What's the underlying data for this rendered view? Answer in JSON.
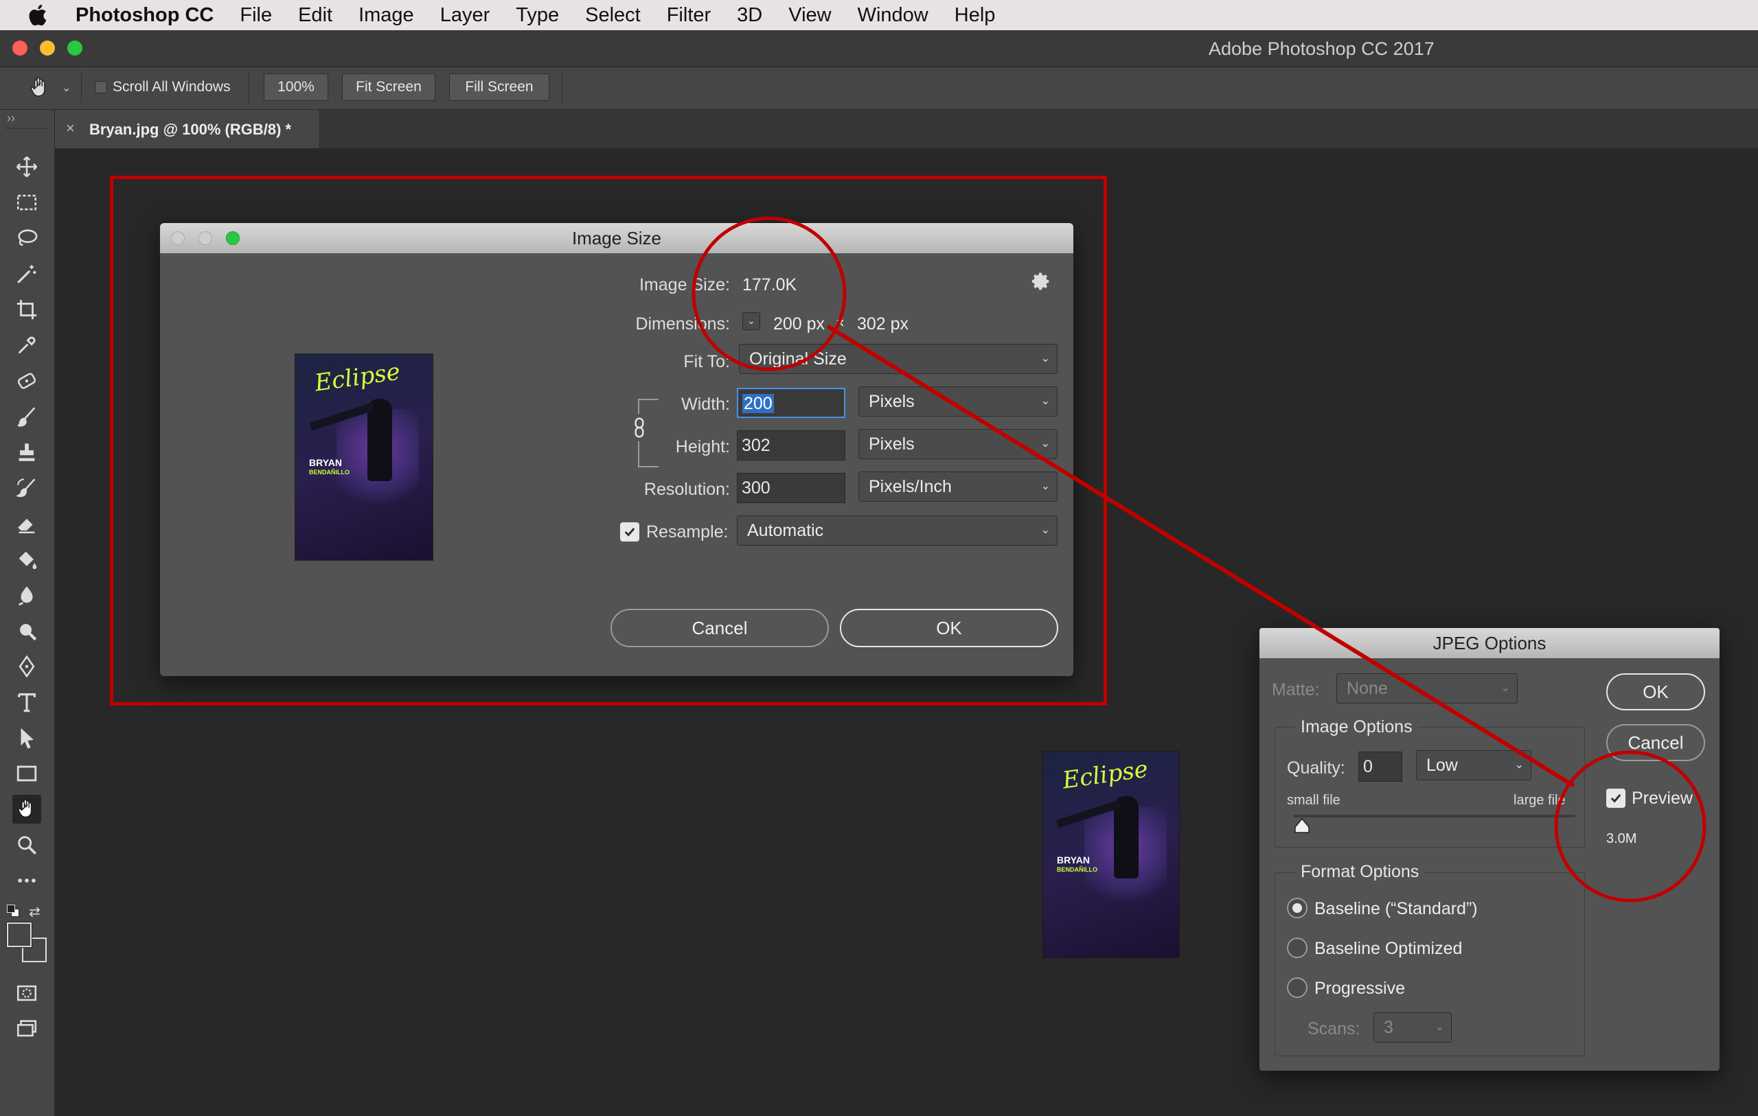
{
  "menubar": {
    "app_name": "Photoshop CC",
    "items": [
      "File",
      "Edit",
      "Image",
      "Layer",
      "Type",
      "Select",
      "Filter",
      "3D",
      "View",
      "Window",
      "Help"
    ]
  },
  "window": {
    "title": "Adobe Photoshop CC 2017"
  },
  "options_bar": {
    "tool_icon": "hand-icon",
    "scroll_all_label": "Scroll All Windows",
    "zoom_100": "100%",
    "fit_screen": "Fit Screen",
    "fill_screen": "Fill Screen"
  },
  "document_tab": {
    "close": "×",
    "label": "Bryan.jpg @ 100% (RGB/8) *"
  },
  "toolbar_expand": "››",
  "image_size": {
    "title": "Image Size",
    "image_size_label": "Image Size:",
    "image_size_value": "177.0K",
    "dimensions_label": "Dimensions:",
    "dim_width": "200 px",
    "dim_times": "×",
    "dim_height": "302 px",
    "fit_to_label": "Fit To:",
    "fit_to_value": "Original Size",
    "width_label": "Width:",
    "width_value": "200",
    "width_unit": "Pixels",
    "height_label": "Height:",
    "height_value": "302",
    "height_unit": "Pixels",
    "resolution_label": "Resolution:",
    "resolution_value": "300",
    "resolution_unit": "Pixels/Inch",
    "resample_label": "Resample:",
    "resample_value": "Automatic",
    "resample_checked": true,
    "cancel": "Cancel",
    "ok": "OK"
  },
  "poster": {
    "title": "Eclipse",
    "name": "BRYAN",
    "subtitle": "BENDAÑILLO"
  },
  "jpeg_options": {
    "title": "JPEG Options",
    "matte_label": "Matte:",
    "matte_value": "None",
    "ok": "OK",
    "cancel": "Cancel",
    "preview_label": "Preview",
    "preview_checked": true,
    "file_size": "3.0M",
    "image_options_legend": "Image Options",
    "quality_label": "Quality:",
    "quality_value": "0",
    "quality_preset": "Low",
    "small_file": "small file",
    "large_file": "large file",
    "quality_slider_level": 0,
    "format_options_legend": "Format Options",
    "baseline_standard": "Baseline (“Standard”)",
    "baseline_optimized": "Baseline Optimized",
    "progressive": "Progressive",
    "selected_format": "Baseline (“Standard”)",
    "scans_label": "Scans:",
    "scans_value": "3"
  },
  "colors": {
    "annotation": "#c00000",
    "close": "#fe5f57",
    "minimize": "#febc2e",
    "zoom": "#28c840"
  }
}
